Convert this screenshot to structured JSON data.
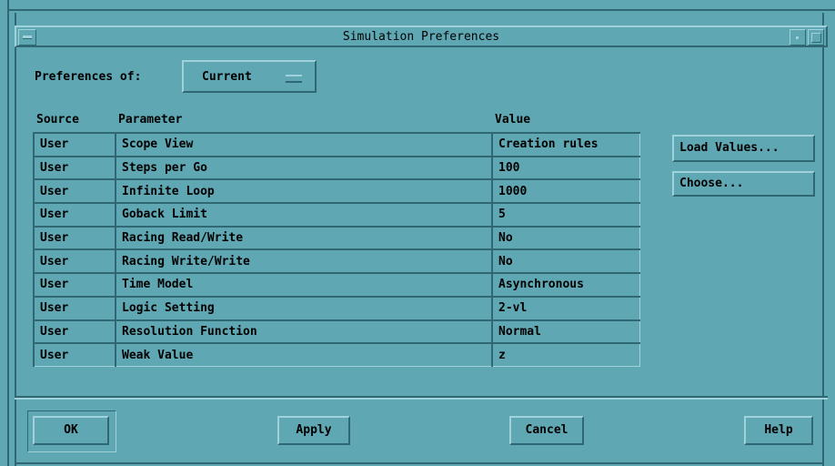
{
  "window": {
    "title": "Simulation Preferences"
  },
  "prefs_label": "Preferences of:",
  "prefs_of": {
    "selected": "Current"
  },
  "table": {
    "headers": {
      "source": "Source",
      "parameter": "Parameter",
      "value": "Value"
    },
    "rows": [
      {
        "source": "User",
        "parameter": "Scope View",
        "value": "Creation rules"
      },
      {
        "source": "User",
        "parameter": "Steps per Go",
        "value": "100"
      },
      {
        "source": "User",
        "parameter": "Infinite Loop",
        "value": "1000"
      },
      {
        "source": "User",
        "parameter": "Goback Limit",
        "value": "5"
      },
      {
        "source": "User",
        "parameter": "Racing Read/Write",
        "value": "No"
      },
      {
        "source": "User",
        "parameter": "Racing Write/Write",
        "value": "No"
      },
      {
        "source": "User",
        "parameter": "Time Model",
        "value": "Asynchronous"
      },
      {
        "source": "User",
        "parameter": "Logic Setting",
        "value": "2-vl"
      },
      {
        "source": "User",
        "parameter": "Resolution Function",
        "value": "Normal"
      },
      {
        "source": "User",
        "parameter": "Weak Value",
        "value": "z"
      }
    ]
  },
  "side_buttons": {
    "load_values": "Load Values...",
    "choose": "Choose..."
  },
  "footer": {
    "ok": "OK",
    "apply": "Apply",
    "cancel": "Cancel",
    "help": "Help"
  },
  "colors": {
    "background": "#5ea7b3",
    "highlight": "#9fd2da",
    "shadow": "#2f6873"
  }
}
